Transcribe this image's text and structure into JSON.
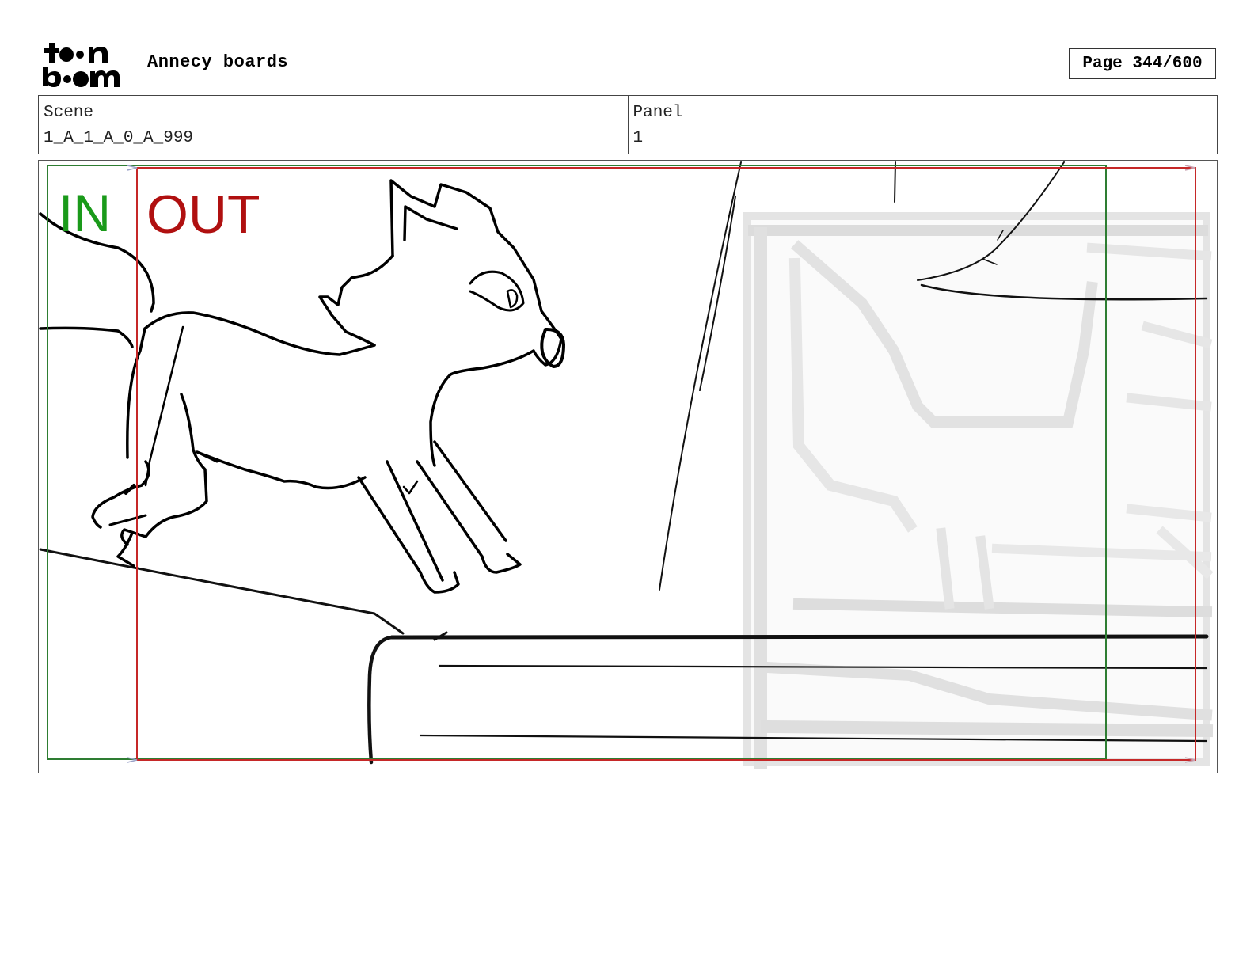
{
  "header": {
    "logo_text_top": "toon",
    "logo_text_bottom": "boom",
    "title": "Annecy boards",
    "page_indicator": "Page 344/600"
  },
  "info": {
    "scene_label": "Scene",
    "scene_value": "1_A_1_A_0_A_999",
    "panel_label": "Panel",
    "panel_value": "1"
  },
  "panel_art": {
    "in_label": "IN",
    "out_label": "OUT",
    "in_color": "#1a9a1a",
    "out_color": "#b01010",
    "in_frame_color": "#2e7d32",
    "out_frame_color": "#c62828",
    "subject": "cat-sketch"
  }
}
